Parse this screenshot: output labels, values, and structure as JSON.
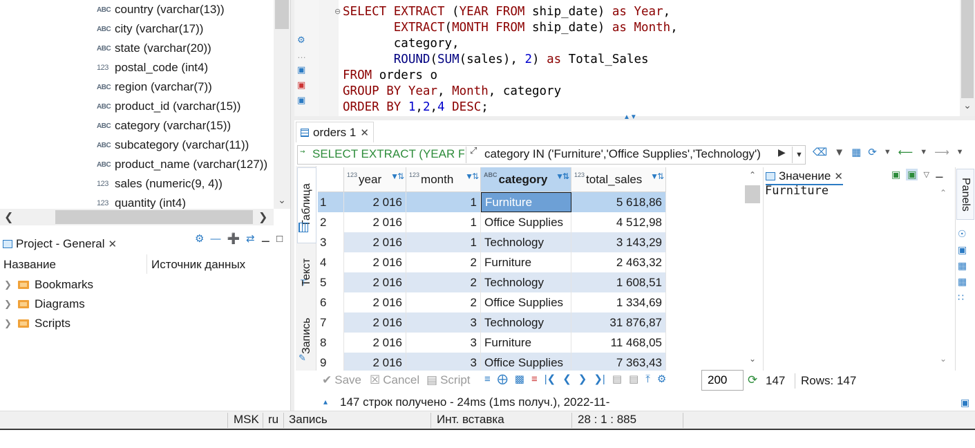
{
  "nav": {
    "columns": [
      {
        "type": "ABC",
        "name": "country (varchar(13))"
      },
      {
        "type": "ABC",
        "name": "city (varchar(17))"
      },
      {
        "type": "ABC",
        "name": "state (varchar(20))"
      },
      {
        "type": "123",
        "name": "postal_code (int4)"
      },
      {
        "type": "ABC",
        "name": "region (varchar(7))"
      },
      {
        "type": "ABC",
        "name": "product_id (varchar(15))"
      },
      {
        "type": "ABC",
        "name": "category (varchar(15))"
      },
      {
        "type": "ABC",
        "name": "subcategory (varchar(11))"
      },
      {
        "type": "ABC",
        "name": "product_name (varchar(127))"
      },
      {
        "type": "123",
        "name": "sales (numeric(9, 4))"
      },
      {
        "type": "123",
        "name": "quantity (int4)"
      }
    ]
  },
  "project": {
    "tab_label": "Project - General",
    "col_name": "Название",
    "col_source": "Источник данных",
    "items": [
      "Bookmarks",
      "Diagrams",
      "Scripts"
    ]
  },
  "editor": {
    "lines": [
      "SELECT EXTRACT (YEAR FROM ship_date) as Year,",
      "       EXTRACT(MONTH FROM ship_date) as Month,",
      "       category,",
      "       ROUND(SUM(sales), 2) as Total_Sales",
      "FROM orders o",
      "GROUP BY Year, Month, category",
      "ORDER BY 1,2,4 DESC;"
    ]
  },
  "results": {
    "tab_label": "orders 1",
    "filter_sql": "SELECT EXTRACT (YEAR FRC",
    "filter_expr": "category IN ('Furniture','Office Supplies','Technology')",
    "side_tabs": {
      "table": "Таблица",
      "text": "Текст",
      "record": "Запись"
    },
    "columns": [
      {
        "type": "123",
        "name": "year"
      },
      {
        "type": "123",
        "name": "month"
      },
      {
        "type": "ABC",
        "name": "category"
      },
      {
        "type": "123",
        "name": "total_sales"
      }
    ],
    "rows": [
      {
        "n": "1",
        "year": "2 016",
        "month": "1",
        "category": "Furniture",
        "total": "5 618,86"
      },
      {
        "n": "2",
        "year": "2 016",
        "month": "1",
        "category": "Office Supplies",
        "total": "4 512,98"
      },
      {
        "n": "3",
        "year": "2 016",
        "month": "1",
        "category": "Technology",
        "total": "3 143,29"
      },
      {
        "n": "4",
        "year": "2 016",
        "month": "2",
        "category": "Furniture",
        "total": "2 463,32"
      },
      {
        "n": "5",
        "year": "2 016",
        "month": "2",
        "category": "Technology",
        "total": "1 608,51"
      },
      {
        "n": "6",
        "year": "2 016",
        "month": "2",
        "category": "Office Supplies",
        "total": "1 334,69"
      },
      {
        "n": "7",
        "year": "2 016",
        "month": "3",
        "category": "Technology",
        "total": "31 876,87"
      },
      {
        "n": "8",
        "year": "2 016",
        "month": "3",
        "category": "Furniture",
        "total": "11 468,05"
      },
      {
        "n": "9",
        "year": "2 016",
        "month": "3",
        "category": "Office Supplies",
        "total": "7 363,43"
      }
    ],
    "value_panel": {
      "tab_label": "Значение",
      "value": "Furniture"
    },
    "panels_label": "Panels",
    "toolbar": {
      "save": "Save",
      "cancel": "Cancel",
      "script": "Script",
      "limit": "200",
      "fetched": "147",
      "rows_label": "Rows: 147"
    },
    "status_message": "147 строк получено - 24ms (1ms получ.), 2022-11-"
  },
  "statusbar": {
    "timezone": "MSK",
    "locale": "ru",
    "mode": "Запись",
    "insert_mode": "Инт. вставка",
    "position": "28 : 1 : 885"
  }
}
